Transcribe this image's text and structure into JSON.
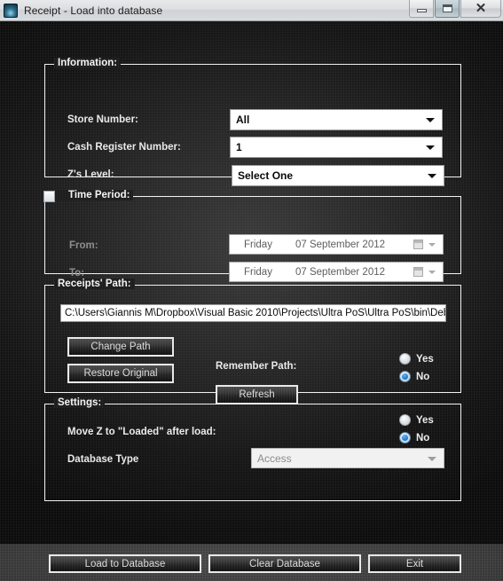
{
  "window": {
    "title": "Receipt - Load into database",
    "icon": "app-icon",
    "buttons": {
      "minimize": "minimize-icon",
      "maximize": "maximize-icon",
      "close": "✕"
    }
  },
  "information": {
    "title": "Information:",
    "store_number": {
      "label": "Store Number:",
      "value": "All"
    },
    "cash_register_number": {
      "label": "Cash Register Number:",
      "value": "1"
    },
    "zs_level": {
      "label": "Z's Level:",
      "value": "Select One"
    }
  },
  "time_period": {
    "title": "Time Period:",
    "checked": false,
    "from": {
      "label": "From:",
      "day": "Friday",
      "date": "07 September 2012"
    },
    "to": {
      "label": "To:",
      "day": "Friday",
      "date": "07 September 2012"
    }
  },
  "receipts_path": {
    "title": "Receipts' Path:",
    "path_value": "C:\\Users\\Giannis M\\Dropbox\\Visual Basic 2010\\Projects\\Ultra PoS\\Ultra PoS\\bin\\Debug",
    "change_path_label": "Change Path",
    "restore_original_label": "Restore Original",
    "remember_path_label": "Remember Path:",
    "refresh_label": "Refresh",
    "remember_yes": "Yes",
    "remember_no": "No",
    "remember_selected": "No"
  },
  "settings": {
    "title": "Settings:",
    "move_z_label": "Move Z to \"Loaded\" after load:",
    "move_z_yes": "Yes",
    "move_z_no": "No",
    "move_z_selected": "No",
    "database_type_label": "Database Type",
    "database_type_value": "Access"
  },
  "footer": {
    "load_label": "Load to Database",
    "clear_label": "Clear Database",
    "exit_label": "Exit"
  },
  "colors": {
    "accent": "#1b7fd4",
    "border": "#f2f2f2",
    "text": "#e9e9e9"
  }
}
